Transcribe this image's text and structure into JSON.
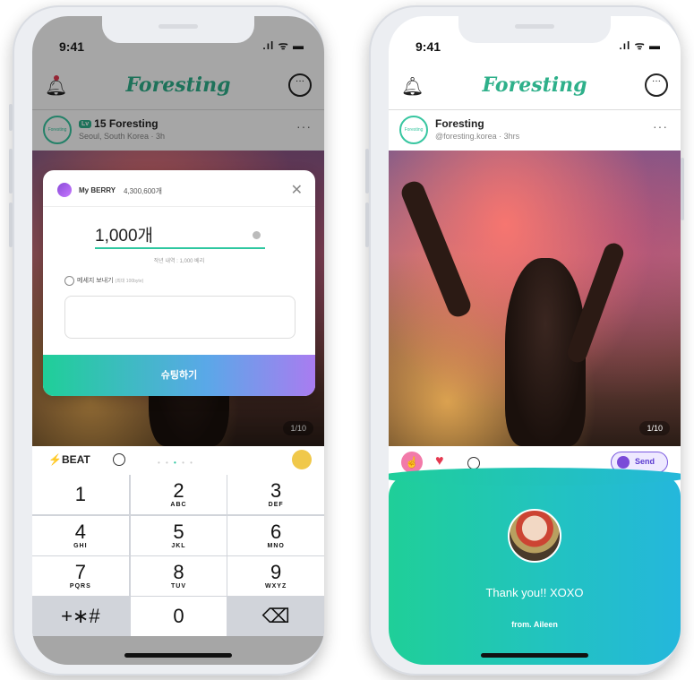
{
  "left": {
    "status": {
      "time": "9:41"
    },
    "brand": "Foresting",
    "post": {
      "level": "Lv",
      "name": "15 Foresting",
      "sub": "Seoul, South Korea · 3h"
    },
    "counter": "1/10",
    "modal": {
      "berry_label": "My BERRY",
      "berry_count": "4,300,600개",
      "amount": "1,000개",
      "hint": "작년 내역 : 1,000 베리",
      "message_label": "메세지 보내기",
      "message_sub": "(최대 100byte)",
      "submit": "슈팅하기"
    },
    "actionbar": {
      "beat": "BEAT"
    },
    "keypad": [
      {
        "num": "1",
        "letters": ""
      },
      {
        "num": "2",
        "letters": "ABC"
      },
      {
        "num": "3",
        "letters": "DEF"
      },
      {
        "num": "4",
        "letters": "GHI"
      },
      {
        "num": "5",
        "letters": "JKL"
      },
      {
        "num": "6",
        "letters": "MNO"
      },
      {
        "num": "7",
        "letters": "PQRS"
      },
      {
        "num": "8",
        "letters": "TUV"
      },
      {
        "num": "9",
        "letters": "WXYZ"
      },
      {
        "num": "+∗#",
        "letters": ""
      },
      {
        "num": "0",
        "letters": ""
      },
      {
        "num": "⌫",
        "letters": ""
      }
    ]
  },
  "right": {
    "status": {
      "time": "9:41"
    },
    "brand": "Foresting",
    "post": {
      "name": "Foresting",
      "sub": "@foresting.korea · 3hrs"
    },
    "counter": "1/10",
    "send_label": "Send",
    "thanks": {
      "message": "Thank you!! XOXO",
      "from": "from. Aileen"
    }
  },
  "colors": {
    "brand": "#2eb08a",
    "accent": "#1fcf98",
    "berry": "#8a4bd8",
    "heart": "#e53950"
  }
}
